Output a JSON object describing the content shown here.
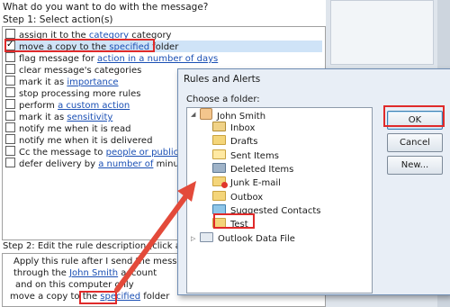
{
  "wizard": {
    "prompt": "What do you want to do with the message?",
    "step1_label": "Step 1: Select action(s)",
    "actions": [
      {
        "parts": [
          {
            "t": "assign it to the "
          },
          {
            "t": "category",
            "link": true
          },
          {
            "t": " category"
          }
        ],
        "checked": false
      },
      {
        "parts": [
          {
            "t": "move a copy to the "
          },
          {
            "t": "specified",
            "link": true
          },
          {
            "t": " folder"
          }
        ],
        "checked": true
      },
      {
        "parts": [
          {
            "t": "flag message for "
          },
          {
            "t": "action in a number of days",
            "link": true
          }
        ],
        "checked": false
      },
      {
        "parts": [
          {
            "t": "clear message's categories"
          }
        ],
        "checked": false
      },
      {
        "parts": [
          {
            "t": "mark it as "
          },
          {
            "t": "importance",
            "link": true
          }
        ],
        "checked": false
      },
      {
        "parts": [
          {
            "t": "stop processing more rules"
          }
        ],
        "checked": false
      },
      {
        "parts": [
          {
            "t": "perform "
          },
          {
            "t": "a custom action",
            "link": true
          }
        ],
        "checked": false
      },
      {
        "parts": [
          {
            "t": "mark it as "
          },
          {
            "t": "sensitivity",
            "link": true
          }
        ],
        "checked": false
      },
      {
        "parts": [
          {
            "t": "notify me when it is read"
          }
        ],
        "checked": false
      },
      {
        "parts": [
          {
            "t": "notify me when it is delivered"
          }
        ],
        "checked": false
      },
      {
        "parts": [
          {
            "t": "Cc the message to "
          },
          {
            "t": "people or public group",
            "link": true
          }
        ],
        "checked": false
      },
      {
        "parts": [
          {
            "t": "defer delivery by "
          },
          {
            "t": "a number of",
            "link": true
          },
          {
            "t": " minutes"
          }
        ],
        "checked": false
      }
    ],
    "step2_label": "Step 2: Edit the rule description (click an underline",
    "desc": {
      "line1": "Apply this rule after I send the message",
      "line2_prefix": "through the ",
      "line2_link": "John Smith",
      "line2_suffix": " account",
      "line3": "and on this computer only",
      "line4_prefix": "move a copy to the ",
      "line4_link": "specified",
      "line4_suffix": " folder"
    }
  },
  "dialog": {
    "title": "Rules and Alerts",
    "choose_label": "Choose a folder:",
    "root": {
      "label": "John Smith",
      "icon": "user-icon"
    },
    "folders": [
      {
        "label": "Inbox",
        "icon": "inbox-icon"
      },
      {
        "label": "Drafts",
        "icon": "drafts-icon"
      },
      {
        "label": "Sent Items",
        "icon": "sent-items-icon"
      },
      {
        "label": "Deleted Items",
        "icon": "deleted-items-icon"
      },
      {
        "label": "Junk E-mail",
        "icon": "junk-email-icon"
      },
      {
        "label": "Outbox",
        "icon": "outbox-icon"
      },
      {
        "label": "Suggested Contacts",
        "icon": "contacts-icon"
      },
      {
        "label": "Test",
        "icon": "folder-icon",
        "selected": true
      }
    ],
    "data_file": {
      "label": "Outlook Data File",
      "icon": "data-file-icon"
    },
    "buttons": {
      "ok": "OK",
      "cancel": "Cancel",
      "new": "New..."
    }
  },
  "colors": {
    "highlight": "#e02a2a",
    "link": "#1a4fb4",
    "selection": "#cfe3f7"
  }
}
